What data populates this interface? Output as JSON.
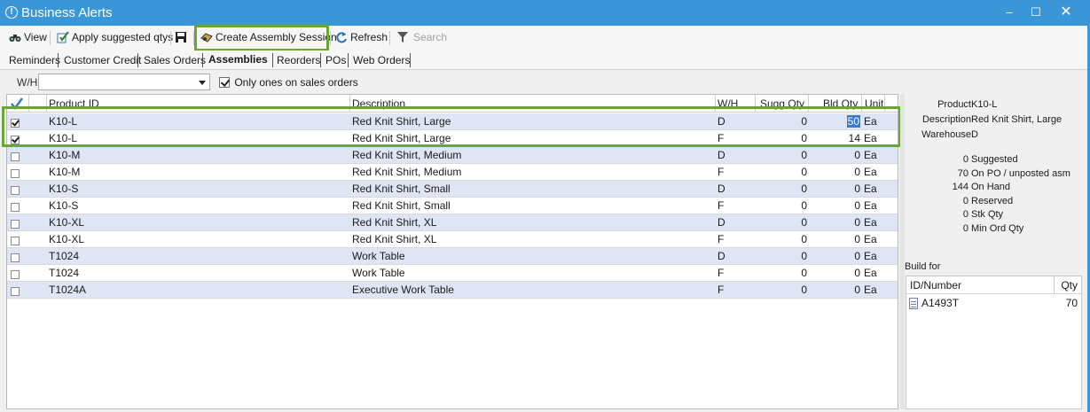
{
  "window": {
    "title": "Business Alerts",
    "title_icon": "alert-icon",
    "controls": [
      "–",
      "☐",
      "✕"
    ]
  },
  "toolbar": {
    "view": "View",
    "apply": "Apply suggested qtys",
    "create": "Create Assembly Session",
    "refresh": "Refresh",
    "search": "Search"
  },
  "tabs": [
    "Reminders",
    "Customer Credit",
    "Sales Orders",
    "Assemblies",
    "Reorders",
    "POs",
    "Web Orders"
  ],
  "active_tab": "Assemblies",
  "filter": {
    "wh_label": "W/H",
    "wh_value": "",
    "only_sales_label": "Only ones on sales orders",
    "only_sales_checked": true
  },
  "grid": {
    "headers": {
      "product": "Product ID",
      "desc": "Description",
      "wh": "W/H",
      "sugg": "Sugg Qty",
      "bld": "Bld Qty",
      "unit": "Unit"
    },
    "rows": [
      {
        "checked": true,
        "product": "K10-L",
        "desc": "Red Knit Shirt, Large",
        "wh": "D",
        "sugg": "0",
        "bld": "50",
        "unit": "Ea"
      },
      {
        "checked": true,
        "product": "K10-L",
        "desc": "Red Knit Shirt, Large",
        "wh": "F",
        "sugg": "0",
        "bld": "14",
        "unit": "Ea"
      },
      {
        "checked": false,
        "product": "K10-M",
        "desc": "Red Knit Shirt, Medium",
        "wh": "D",
        "sugg": "0",
        "bld": "0",
        "unit": "Ea"
      },
      {
        "checked": false,
        "product": "K10-M",
        "desc": "Red Knit Shirt, Medium",
        "wh": "F",
        "sugg": "0",
        "bld": "0",
        "unit": "Ea"
      },
      {
        "checked": false,
        "product": "K10-S",
        "desc": "Red Knit Shirt, Small",
        "wh": "D",
        "sugg": "0",
        "bld": "0",
        "unit": "Ea"
      },
      {
        "checked": false,
        "product": "K10-S",
        "desc": "Red Knit Shirt, Small",
        "wh": "F",
        "sugg": "0",
        "bld": "0",
        "unit": "Ea"
      },
      {
        "checked": false,
        "product": "K10-XL",
        "desc": "Red Knit Shirt, XL",
        "wh": "D",
        "sugg": "0",
        "bld": "0",
        "unit": "Ea"
      },
      {
        "checked": false,
        "product": "K10-XL",
        "desc": "Red Knit Shirt, XL",
        "wh": "F",
        "sugg": "0",
        "bld": "0",
        "unit": "Ea"
      },
      {
        "checked": false,
        "product": "T1024",
        "desc": "Work Table",
        "wh": "D",
        "sugg": "0",
        "bld": "0",
        "unit": "Ea"
      },
      {
        "checked": false,
        "product": "T1024",
        "desc": "Work Table",
        "wh": "F",
        "sugg": "0",
        "bld": "0",
        "unit": "Ea"
      },
      {
        "checked": false,
        "product": "T1024A",
        "desc": "Executive Work Table",
        "wh": "F",
        "sugg": "0",
        "bld": "0",
        "unit": "Ea"
      }
    ]
  },
  "detail": {
    "product_label": "Product",
    "product": "K10-L",
    "desc_label": "Description",
    "desc": "Red Knit Shirt, Large",
    "wh_label": "Warehouse",
    "wh": "D",
    "stats": [
      {
        "n": "0",
        "l": "Suggested"
      },
      {
        "n": "70",
        "l": "On PO / unposted asm"
      },
      {
        "n": "144",
        "l": "On Hand"
      },
      {
        "n": "0",
        "l": "Reserved"
      },
      {
        "n": "0",
        "l": "Stk Qty"
      },
      {
        "n": "0",
        "l": "Min Ord Qty"
      }
    ],
    "build_for_label": "Build for",
    "bf_headers": {
      "id": "ID/Number",
      "qty": "Qty"
    },
    "bf_rows": [
      {
        "id": "A1493T",
        "qty": "70"
      }
    ]
  },
  "colors": {
    "titlebar": "#3a96d7",
    "highlight": "#6aa636",
    "row_shade": "#dfe5f5",
    "selection": "#3c79c8"
  }
}
